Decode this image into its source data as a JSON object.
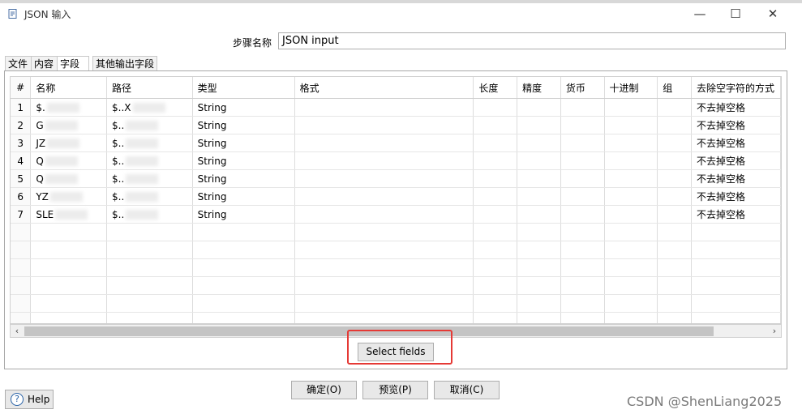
{
  "window": {
    "title": "JSON 输入",
    "minimize": "—",
    "maximize": "☐",
    "close": "✕"
  },
  "step": {
    "label": "步骤名称",
    "value": "JSON input"
  },
  "tabs": [
    "文件",
    "内容",
    "字段",
    "其他输出字段"
  ],
  "active_tab": "字段",
  "columns": [
    "#",
    "名称",
    "路径",
    "类型",
    "格式",
    "长度",
    "精度",
    "货币",
    "十进制",
    "组",
    "去除空字符的方式"
  ],
  "rows": [
    {
      "num": "1",
      "name": "$.",
      "path": "$..X",
      "type": "String",
      "trim": "不去掉空格"
    },
    {
      "num": "2",
      "name": "G",
      "path": "$..",
      "type": "String",
      "trim": "不去掉空格"
    },
    {
      "num": "3",
      "name": "JZ",
      "path": "$..",
      "type": "String",
      "trim": "不去掉空格"
    },
    {
      "num": "4",
      "name": "Q",
      "path": "$..",
      "type": "String",
      "trim": "不去掉空格"
    },
    {
      "num": "5",
      "name": "Q",
      "path": "$..",
      "type": "String",
      "trim": "不去掉空格"
    },
    {
      "num": "6",
      "name": "YZ",
      "path": "$..",
      "type": "String",
      "trim": "不去掉空格"
    },
    {
      "num": "7",
      "name": "SLE",
      "path": "$..",
      "type": "String",
      "trim": "不去掉空格"
    }
  ],
  "empty_rows": 6,
  "buttons": {
    "select_fields": "Select fields",
    "ok": "确定(O)",
    "preview": "预览(P)",
    "cancel": "取消(C)",
    "help": "Help"
  },
  "scroll": {
    "left": "‹",
    "right": "›"
  },
  "watermark": "CSDN @ShenLiang2025",
  "colors": {
    "highlight_box": "#e53935",
    "accent": "#2a63a8"
  },
  "icons": {
    "app": "document-icon",
    "help": "question-icon"
  }
}
